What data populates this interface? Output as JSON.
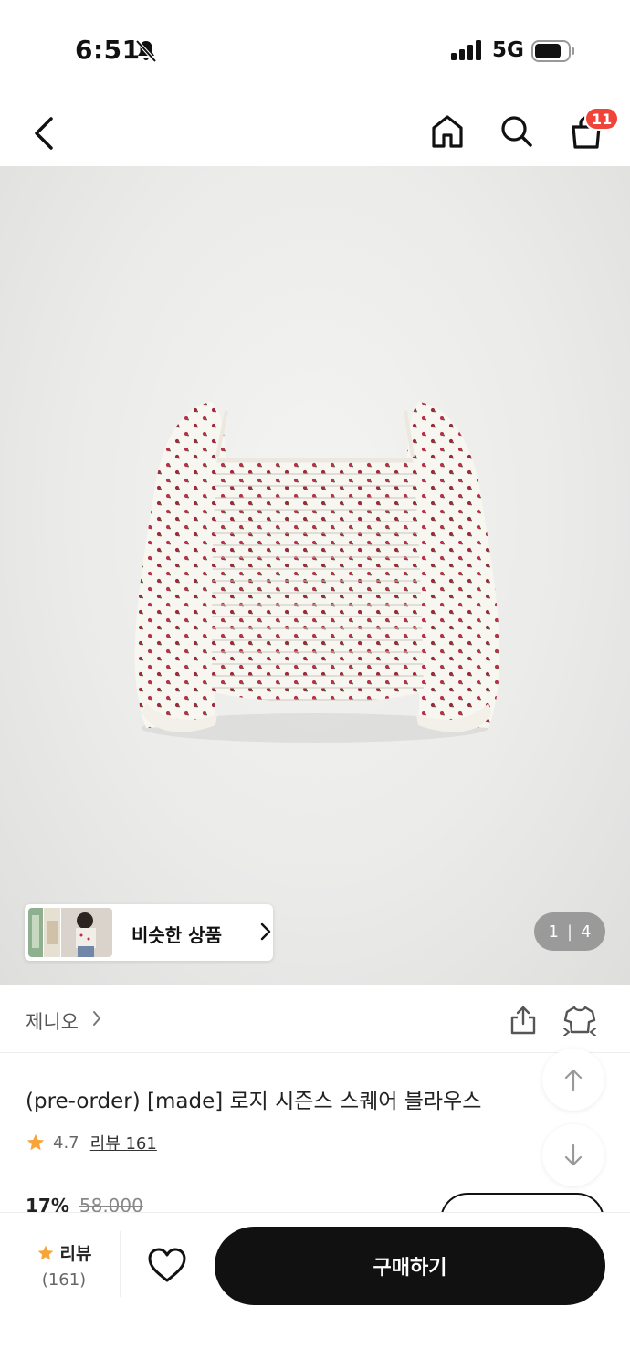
{
  "status_bar": {
    "time": "6:51",
    "network": "5G",
    "icons": [
      "bell-off-icon",
      "signal-icon",
      "battery-icon"
    ]
  },
  "nav": {
    "icons": [
      "back-icon",
      "home-icon",
      "search-icon",
      "cart-icon"
    ],
    "cart_badge": "11",
    "badge_color": "#f0443a"
  },
  "hero": {
    "similar_label": "비슷한 상품",
    "page_current": "1",
    "page_separator": "|",
    "page_total": "4"
  },
  "brand": {
    "name": "제니오",
    "icons": [
      "share-icon",
      "fitting-icon"
    ]
  },
  "product": {
    "title": "(pre-order) [made] 로지 시즌스 스퀘어 블라우스",
    "rating": "4.7",
    "review_link": "리뷰 161",
    "discount": "17%",
    "original_price": "58,000",
    "star_color": "#f7a53a"
  },
  "bottom_bar": {
    "review_label": "리뷰",
    "review_count": "(161)",
    "buy_label": "구매하기",
    "buy_color": "#111111"
  }
}
